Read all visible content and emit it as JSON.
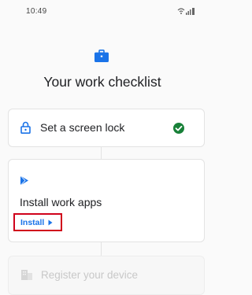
{
  "status_bar": {
    "time": "10:49",
    "icons": [
      "wifi-icon",
      "signal-icon",
      "battery-icon"
    ]
  },
  "header": {
    "icon": "briefcase-icon",
    "title": "Your work checklist"
  },
  "checklist": {
    "screen_lock": {
      "icon": "lock-icon",
      "label": "Set a screen lock",
      "status": "completed",
      "status_icon": "check-circle-icon"
    },
    "work_apps": {
      "icon": "play-store-icon",
      "label": "Install work apps",
      "action_label": "Install",
      "action_icon": "chevron-right-icon"
    },
    "register_device": {
      "icon": "building-icon",
      "label": "Register your device",
      "state": "disabled"
    }
  },
  "colors": {
    "accent": "#1a73e8",
    "check": "#188038",
    "highlight_border": "#d0021b",
    "disabled_text": "#c8c8c8"
  }
}
